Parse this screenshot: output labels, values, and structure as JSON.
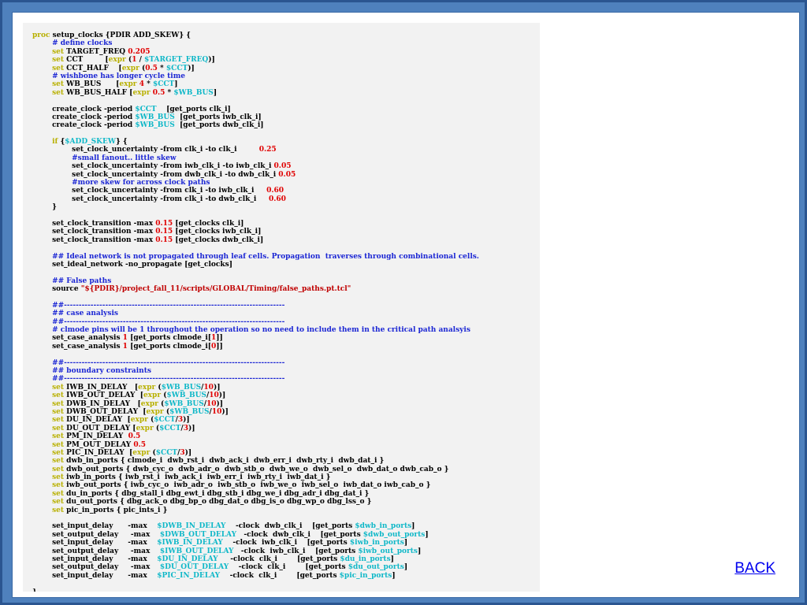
{
  "colors": {
    "frame": "#4f81bd",
    "panel": "#f2f2f2",
    "keyword": "#b8b000",
    "comment": "#1c27d4",
    "number": "#e00000",
    "variable": "#10b8c8",
    "string": "#c00000",
    "link": "#0000ee"
  },
  "navigation": {
    "back_label": "BACK"
  },
  "code": [
    [
      [
        "kw",
        "proc"
      ],
      [
        "p",
        " setup_clocks {PDIR ADD_SKEW} {"
      ]
    ],
    [
      [
        "p",
        "        "
      ],
      [
        "cm",
        "# define clocks"
      ]
    ],
    [
      [
        "p",
        "        "
      ],
      [
        "kw",
        "set"
      ],
      [
        "p",
        " TARGET_FREQ "
      ],
      [
        "num",
        "0.205"
      ]
    ],
    [
      [
        "p",
        "        "
      ],
      [
        "kw",
        "set"
      ],
      [
        "p",
        " CCT         ["
      ],
      [
        "kw",
        "expr"
      ],
      [
        "p",
        " ("
      ],
      [
        "num",
        "1"
      ],
      [
        "p",
        " / "
      ],
      [
        "var",
        "$TARGET_FREQ"
      ],
      [
        "p",
        ")]"
      ]
    ],
    [
      [
        "p",
        "        "
      ],
      [
        "kw",
        "set"
      ],
      [
        "p",
        " CCT_HALF    ["
      ],
      [
        "kw",
        "expr"
      ],
      [
        "p",
        " ("
      ],
      [
        "num",
        "0.5"
      ],
      [
        "p",
        " * "
      ],
      [
        "var",
        "$CCT"
      ],
      [
        "p",
        ")]"
      ]
    ],
    [
      [
        "p",
        "        "
      ],
      [
        "cm",
        "# wishbone has longer cycle time"
      ]
    ],
    [
      [
        "p",
        "        "
      ],
      [
        "kw",
        "set"
      ],
      [
        "p",
        " WB_BUS      ["
      ],
      [
        "kw",
        "expr"
      ],
      [
        "p",
        " "
      ],
      [
        "num",
        "4"
      ],
      [
        "p",
        " * "
      ],
      [
        "var",
        "$CCT"
      ],
      [
        "p",
        "]"
      ]
    ],
    [
      [
        "p",
        "        "
      ],
      [
        "kw",
        "set"
      ],
      [
        "p",
        " WB_BUS_HALF ["
      ],
      [
        "kw",
        "expr"
      ],
      [
        "p",
        " "
      ],
      [
        "num",
        "0.5"
      ],
      [
        "p",
        " * "
      ],
      [
        "var",
        "$WB_BUS"
      ],
      [
        "p",
        "]"
      ]
    ],
    [
      [
        "p",
        ""
      ]
    ],
    [
      [
        "p",
        "        create_clock -period "
      ],
      [
        "var",
        "$CCT"
      ],
      [
        "p",
        "    [get_ports clk_i]"
      ]
    ],
    [
      [
        "p",
        "        create_clock -period "
      ],
      [
        "var",
        "$WB_BUS"
      ],
      [
        "p",
        "  [get_ports iwb_clk_i]"
      ]
    ],
    [
      [
        "p",
        "        create_clock -period "
      ],
      [
        "var",
        "$WB_BUS"
      ],
      [
        "p",
        "  [get_ports dwb_clk_i]"
      ]
    ],
    [
      [
        "p",
        ""
      ]
    ],
    [
      [
        "p",
        "        "
      ],
      [
        "kw",
        "if"
      ],
      [
        "p",
        " {"
      ],
      [
        "var",
        "$ADD_SKEW"
      ],
      [
        "p",
        "} {"
      ]
    ],
    [
      [
        "p",
        "                set_clock_uncertainty -from clk_i -to clk_i         "
      ],
      [
        "num",
        "0.25"
      ]
    ],
    [
      [
        "p",
        "                "
      ],
      [
        "cm",
        "#small fanout.. little skew"
      ]
    ],
    [
      [
        "p",
        "                set_clock_uncertainty -from iwb_clk_i -to iwb_clk_i "
      ],
      [
        "num",
        "0.05"
      ]
    ],
    [
      [
        "p",
        "                set_clock_uncertainty -from dwb_clk_i -to dwb_clk_i "
      ],
      [
        "num",
        "0.05"
      ]
    ],
    [
      [
        "p",
        "                "
      ],
      [
        "cm",
        "#more skew for across clock paths"
      ]
    ],
    [
      [
        "p",
        "                set_clock_uncertainty -from clk_i -to iwb_clk_i     "
      ],
      [
        "num",
        "0.60"
      ]
    ],
    [
      [
        "p",
        "                set_clock_uncertainty -from clk_i -to dwb_clk_i     "
      ],
      [
        "num",
        "0.60"
      ]
    ],
    [
      [
        "p",
        "        }"
      ]
    ],
    [
      [
        "p",
        ""
      ]
    ],
    [
      [
        "p",
        "        set_clock_transition -max "
      ],
      [
        "num",
        "0.15"
      ],
      [
        "p",
        " [get_clocks clk_i]"
      ]
    ],
    [
      [
        "p",
        "        set_clock_transition -max "
      ],
      [
        "num",
        "0.15"
      ],
      [
        "p",
        " [get_clocks iwb_clk_i]"
      ]
    ],
    [
      [
        "p",
        "        set_clock_transition -max "
      ],
      [
        "num",
        "0.15"
      ],
      [
        "p",
        " [get_clocks dwb_clk_i]"
      ]
    ],
    [
      [
        "p",
        ""
      ]
    ],
    [
      [
        "p",
        "        "
      ],
      [
        "cm",
        "## Ideal network is not propagated through leaf cells. Propagation  traverses through combinational cells."
      ]
    ],
    [
      [
        "p",
        "        set_ideal_network -no_propagate [get_clocks]"
      ]
    ],
    [
      [
        "p",
        ""
      ]
    ],
    [
      [
        "p",
        "        "
      ],
      [
        "cm",
        "## False paths"
      ]
    ],
    [
      [
        "p",
        "        source "
      ],
      [
        "str",
        "\"${PDIR}/project_fall_11/scripts/GLOBAL/Timing/false_paths.pt.tcl\""
      ]
    ],
    [
      [
        "p",
        ""
      ]
    ],
    [
      [
        "p",
        "        "
      ],
      [
        "cm",
        "##---------------------------------------------------------------------------"
      ]
    ],
    [
      [
        "p",
        "        "
      ],
      [
        "cm",
        "## case analysis"
      ]
    ],
    [
      [
        "p",
        "        "
      ],
      [
        "cm",
        "##---------------------------------------------------------------------------"
      ]
    ],
    [
      [
        "p",
        "        "
      ],
      [
        "cm",
        "# clmode pins will be 1 throughout the operation so no need to include them in the critical path analsyis"
      ]
    ],
    [
      [
        "p",
        "        set_case_analysis "
      ],
      [
        "num",
        "1"
      ],
      [
        "p",
        " [get_ports clmode_i["
      ],
      [
        "num",
        "1"
      ],
      [
        "p",
        "]]"
      ]
    ],
    [
      [
        "p",
        "        set_case_analysis "
      ],
      [
        "num",
        "1"
      ],
      [
        "p",
        " [get_ports clmode_i["
      ],
      [
        "num",
        "0"
      ],
      [
        "p",
        "]]"
      ]
    ],
    [
      [
        "p",
        ""
      ]
    ],
    [
      [
        "p",
        "        "
      ],
      [
        "cm",
        "##---------------------------------------------------------------------------"
      ]
    ],
    [
      [
        "p",
        "        "
      ],
      [
        "cm",
        "## boundary constraints"
      ]
    ],
    [
      [
        "p",
        "        "
      ],
      [
        "cm",
        "##---------------------------------------------------------------------------"
      ]
    ],
    [
      [
        "p",
        "        "
      ],
      [
        "kw",
        "set"
      ],
      [
        "p",
        " IWB_IN_DELAY   ["
      ],
      [
        "kw",
        "expr"
      ],
      [
        "p",
        " ("
      ],
      [
        "var",
        "$WB_BUS"
      ],
      [
        "p",
        "/"
      ],
      [
        "num",
        "10"
      ],
      [
        "p",
        ")]"
      ]
    ],
    [
      [
        "p",
        "        "
      ],
      [
        "kw",
        "set"
      ],
      [
        "p",
        " IWB_OUT_DELAY  ["
      ],
      [
        "kw",
        "expr"
      ],
      [
        "p",
        " ("
      ],
      [
        "var",
        "$WB_BUS"
      ],
      [
        "p",
        "/"
      ],
      [
        "num",
        "10"
      ],
      [
        "p",
        ")]"
      ]
    ],
    [
      [
        "p",
        "        "
      ],
      [
        "kw",
        "set"
      ],
      [
        "p",
        " DWB_IN_DELAY   ["
      ],
      [
        "kw",
        "expr"
      ],
      [
        "p",
        " ("
      ],
      [
        "var",
        "$WB_BUS"
      ],
      [
        "p",
        "/"
      ],
      [
        "num",
        "10"
      ],
      [
        "p",
        ")]"
      ]
    ],
    [
      [
        "p",
        "        "
      ],
      [
        "kw",
        "set"
      ],
      [
        "p",
        " DWB_OUT_DELAY  ["
      ],
      [
        "kw",
        "expr"
      ],
      [
        "p",
        " ("
      ],
      [
        "var",
        "$WB_BUS"
      ],
      [
        "p",
        "/"
      ],
      [
        "num",
        "10"
      ],
      [
        "p",
        ")]"
      ]
    ],
    [
      [
        "p",
        "        "
      ],
      [
        "kw",
        "set"
      ],
      [
        "p",
        " DU_IN_DELAY  ["
      ],
      [
        "kw",
        "expr"
      ],
      [
        "p",
        " ("
      ],
      [
        "var",
        "$CCT"
      ],
      [
        "p",
        "/"
      ],
      [
        "num",
        "3"
      ],
      [
        "p",
        ")]"
      ]
    ],
    [
      [
        "p",
        "        "
      ],
      [
        "kw",
        "set"
      ],
      [
        "p",
        " DU_OUT_DELAY ["
      ],
      [
        "kw",
        "expr"
      ],
      [
        "p",
        " ("
      ],
      [
        "var",
        "$CCT"
      ],
      [
        "p",
        "/"
      ],
      [
        "num",
        "3"
      ],
      [
        "p",
        ")]"
      ]
    ],
    [
      [
        "p",
        "        "
      ],
      [
        "kw",
        "set"
      ],
      [
        "p",
        " PM_IN_DELAY  "
      ],
      [
        "num",
        "0.5"
      ]
    ],
    [
      [
        "p",
        "        "
      ],
      [
        "kw",
        "set"
      ],
      [
        "p",
        " PM_OUT_DELAY "
      ],
      [
        "num",
        "0.5"
      ]
    ],
    [
      [
        "p",
        "        "
      ],
      [
        "kw",
        "set"
      ],
      [
        "p",
        " PIC_IN_DELAY  ["
      ],
      [
        "kw",
        "expr"
      ],
      [
        "p",
        " ("
      ],
      [
        "var",
        "$CCT"
      ],
      [
        "p",
        "/"
      ],
      [
        "num",
        "3"
      ],
      [
        "p",
        ")]"
      ]
    ],
    [
      [
        "p",
        "        "
      ],
      [
        "kw",
        "set"
      ],
      [
        "p",
        " dwb_in_ports { clmode_i  dwb_rst_i  dwb_ack_i  dwb_err_i  dwb_rty_i  dwb_dat_i }"
      ]
    ],
    [
      [
        "p",
        "        "
      ],
      [
        "kw",
        "set"
      ],
      [
        "p",
        " dwb_out_ports { dwb_cyc_o  dwb_adr_o  dwb_stb_o  dwb_we_o  dwb_sel_o  dwb_dat_o dwb_cab_o }"
      ]
    ],
    [
      [
        "p",
        "        "
      ],
      [
        "kw",
        "set"
      ],
      [
        "p",
        " iwb_in_ports { iwb_rst_i  iwb_ack_i  iwb_err_i  iwb_rty_i  iwb_dat_i }"
      ]
    ],
    [
      [
        "p",
        "        "
      ],
      [
        "kw",
        "set"
      ],
      [
        "p",
        " iwb_out_ports { iwb_cyc_o  iwb_adr_o  iwb_stb_o  iwb_we_o  iwb_sel_o  iwb_dat_o iwb_cab_o }"
      ]
    ],
    [
      [
        "p",
        "        "
      ],
      [
        "kw",
        "set"
      ],
      [
        "p",
        " du_in_ports { dbg_stall_i dbg_ewt_i dbg_stb_i dbg_we_i dbg_adr_i dbg_dat_i }"
      ]
    ],
    [
      [
        "p",
        "        "
      ],
      [
        "kw",
        "set"
      ],
      [
        "p",
        " du_out_ports { dbg_ack_o dbg_bp_o dbg_dat_o dbg_is_o dbg_wp_o dbg_lss_o }"
      ]
    ],
    [
      [
        "p",
        "        "
      ],
      [
        "kw",
        "set"
      ],
      [
        "p",
        " pic_in_ports { pic_ints_i }"
      ]
    ],
    [
      [
        "p",
        ""
      ]
    ],
    [
      [
        "p",
        "        set_input_delay      -max    "
      ],
      [
        "var",
        "$DWB_IN_DELAY"
      ],
      [
        "p",
        "    -clock  dwb_clk_i    [get_ports "
      ],
      [
        "var",
        "$dwb_in_ports"
      ],
      [
        "p",
        "]"
      ]
    ],
    [
      [
        "p",
        "        set_output_delay     -max    "
      ],
      [
        "var",
        "$DWB_OUT_DELAY"
      ],
      [
        "p",
        "   -clock  dwb_clk_i    [get_ports "
      ],
      [
        "var",
        "$dwb_out_ports"
      ],
      [
        "p",
        "]"
      ]
    ],
    [
      [
        "p",
        "        set_input_delay      -max    "
      ],
      [
        "var",
        "$IWB_IN_DELAY"
      ],
      [
        "p",
        "    -clock  iwb_clk_i    [get_ports "
      ],
      [
        "var",
        "$iwb_in_ports"
      ],
      [
        "p",
        "]"
      ]
    ],
    [
      [
        "p",
        "        set_output_delay     -max    "
      ],
      [
        "var",
        "$IWB_OUT_DELAY"
      ],
      [
        "p",
        "   -clock  iwb_clk_i    [get_ports "
      ],
      [
        "var",
        "$iwb_out_ports"
      ],
      [
        "p",
        "]"
      ]
    ],
    [
      [
        "p",
        "        set_input_delay      -max    "
      ],
      [
        "var",
        "$DU_IN_DELAY"
      ],
      [
        "p",
        "     -clock  clk_i        [get_ports "
      ],
      [
        "var",
        "$du_in_ports"
      ],
      [
        "p",
        "]"
      ]
    ],
    [
      [
        "p",
        "        set_output_delay     -max    "
      ],
      [
        "var",
        "$DU_OUT_DELAY"
      ],
      [
        "p",
        "    -clock  clk_i        [get_ports "
      ],
      [
        "var",
        "$du_out_ports"
      ],
      [
        "p",
        "]"
      ]
    ],
    [
      [
        "p",
        "        set_input_delay      -max    "
      ],
      [
        "var",
        "$PIC_IN_DELAY"
      ],
      [
        "p",
        "    -clock  clk_i        [get_ports "
      ],
      [
        "var",
        "$pic_in_ports"
      ],
      [
        "p",
        "]"
      ]
    ],
    [
      [
        "p",
        ""
      ]
    ],
    [
      [
        "p",
        "}"
      ]
    ]
  ]
}
